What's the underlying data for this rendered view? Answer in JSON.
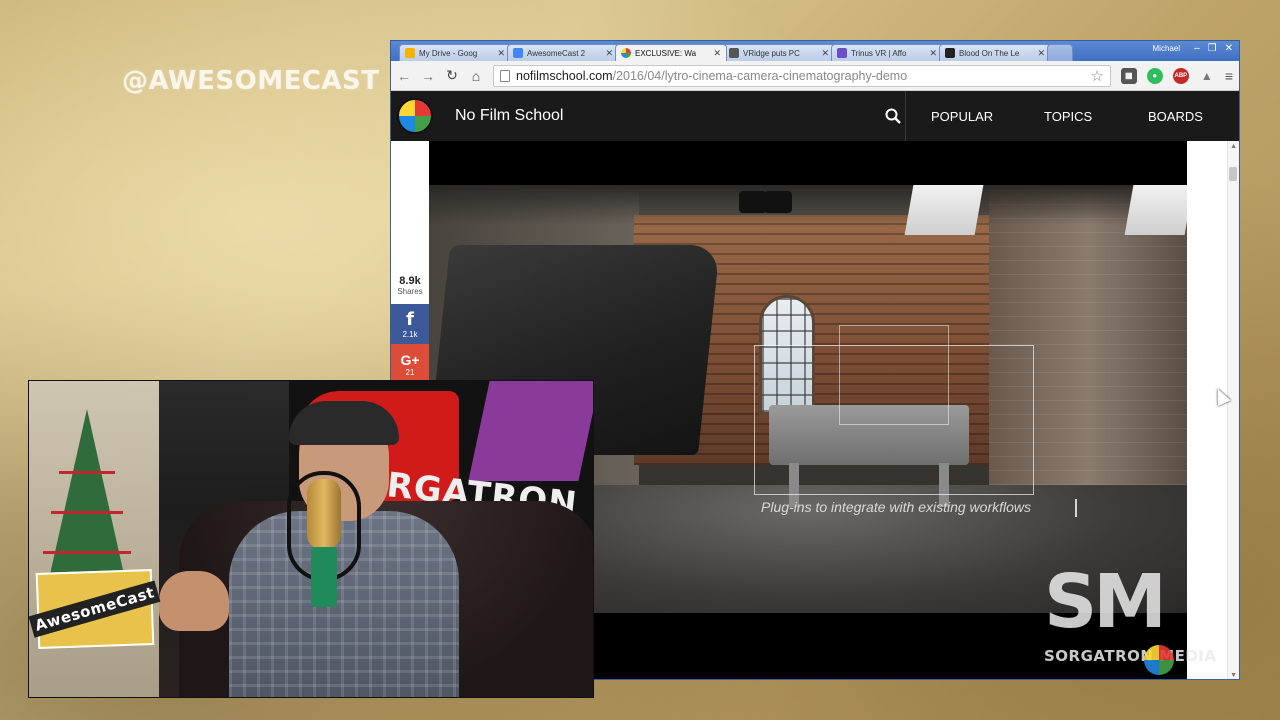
{
  "stream": {
    "handle": "@AWESOMECAST"
  },
  "browser": {
    "tabs": [
      {
        "title": "My Drive - Goog",
        "fav_color": "#f4b400"
      },
      {
        "title": "AwesomeCast 2",
        "fav_color": "#4285f4"
      },
      {
        "title": "EXCLUSIVE: Wa",
        "fav_color": "#e53935",
        "active": true
      },
      {
        "title": "VRidge puts PC",
        "fav_color": "#555555"
      },
      {
        "title": "Trinus VR | Affo",
        "fav_color": "#6a4fc9"
      },
      {
        "title": "Blood On The Le",
        "fav_color": "#222222"
      }
    ],
    "tab_close": "✕",
    "user": "Michael",
    "win_min": "–",
    "win_max": "❐",
    "win_close": "✕",
    "url_host": "nofilmschool.com",
    "url_path": "/2016/04/lytro-cinema-camera-cinematography-demo",
    "ext_abp": "ABP"
  },
  "site": {
    "name": "No Film School",
    "nav": {
      "popular": "POPULAR",
      "topics": "TOPICS",
      "boards": "BOARDS"
    }
  },
  "video": {
    "caption": "Plug-ins to integrate with existing workflows"
  },
  "share": {
    "count": "8.9k",
    "count_label": "Shares",
    "facebook_glyph": "f",
    "facebook_count": "2.1k",
    "google_glyph": "G+",
    "google_count": "21"
  },
  "webcam": {
    "banner_text": "SORGATRON M",
    "logo_text": "AwesomeCast"
  },
  "watermark": {
    "big": "SM",
    "small": "SORGATRON MEDIA"
  },
  "colors": {
    "facebook": "#3b5998",
    "google": "#dd4b39",
    "site_header": "#1a1a1a"
  }
}
